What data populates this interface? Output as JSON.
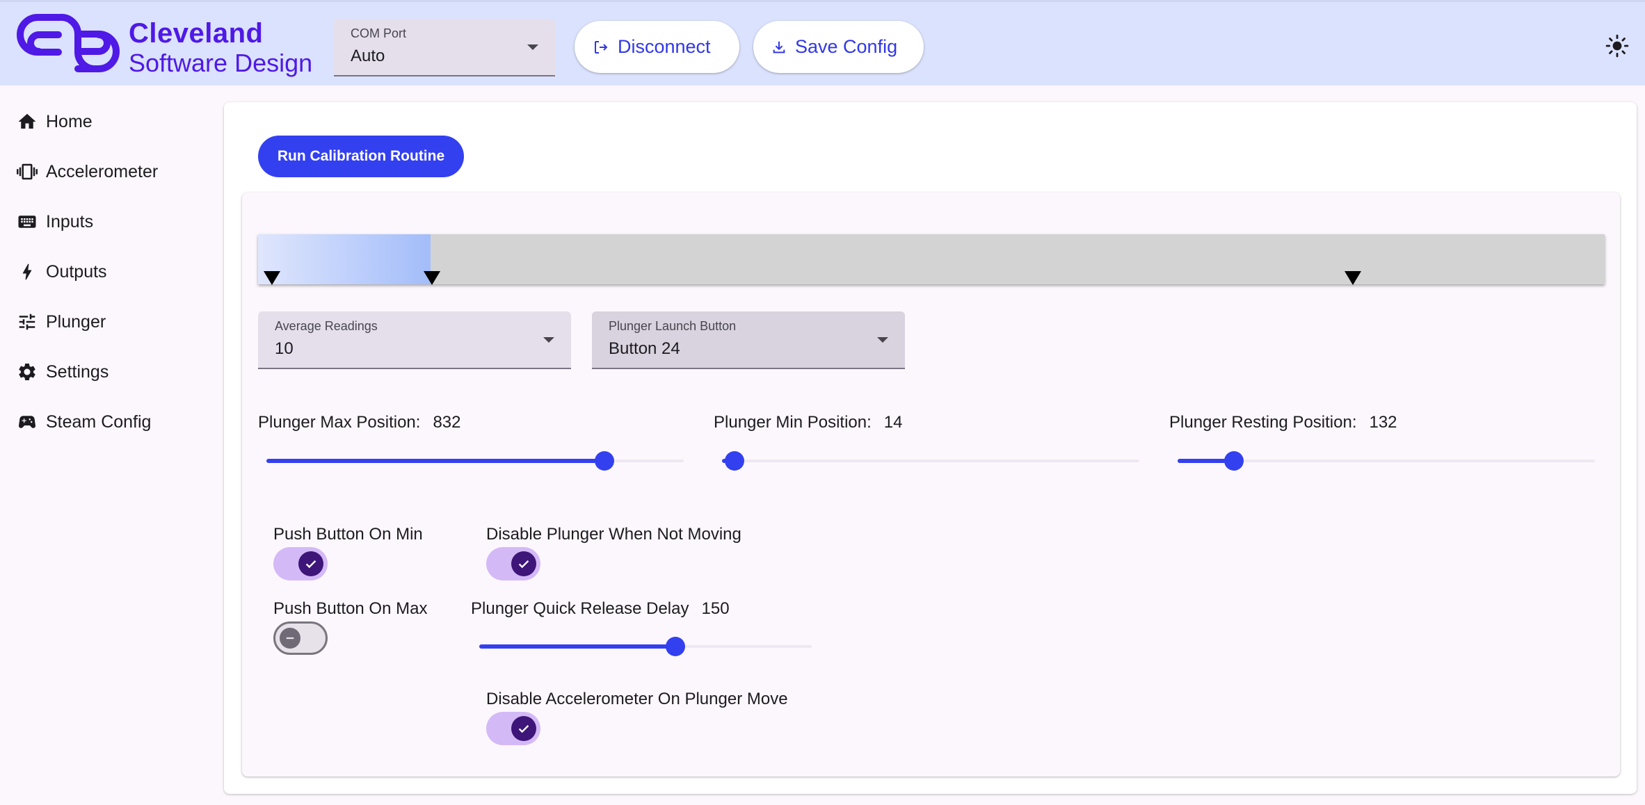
{
  "brand": {
    "line1": "Cleveland",
    "line2": "Software Design"
  },
  "header": {
    "com_port": {
      "label": "COM Port",
      "value": "Auto"
    },
    "disconnect_label": "Disconnect",
    "save_label": "Save Config"
  },
  "sidebar": {
    "items": [
      {
        "label": "Home",
        "icon": "home-icon"
      },
      {
        "label": "Accelerometer",
        "icon": "vibration-icon"
      },
      {
        "label": "Inputs",
        "icon": "keyboard-icon"
      },
      {
        "label": "Outputs",
        "icon": "bolt-icon"
      },
      {
        "label": "Plunger",
        "icon": "tune-icon"
      },
      {
        "label": "Settings",
        "icon": "gear-icon"
      },
      {
        "label": "Steam Config",
        "icon": "gamepad-icon"
      }
    ]
  },
  "main": {
    "calibrate_label": "Run Calibration Routine",
    "average_readings": {
      "label": "Average Readings",
      "value": "10"
    },
    "launch_button": {
      "label": "Plunger Launch Button",
      "value": "Button 24"
    },
    "max_position": {
      "label": "Plunger Max Position:",
      "value": "832",
      "fraction": 0.81
    },
    "min_position": {
      "label": "Plunger Min Position:",
      "value": "14",
      "fraction": 0.03
    },
    "resting_position": {
      "label": "Plunger Resting Position:",
      "value": "132",
      "fraction": 0.135
    },
    "quick_release": {
      "label": "Plunger Quick Release Delay",
      "value": "150",
      "fraction": 0.59
    },
    "switches": {
      "push_on_min": {
        "label": "Push Button On Min",
        "checked": true
      },
      "disable_not_moving": {
        "label": "Disable Plunger When Not Moving",
        "checked": true
      },
      "push_on_max": {
        "label": "Push Button On Max",
        "checked": false
      },
      "disable_accel": {
        "label": "Disable Accelerometer On Plunger Move",
        "checked": true
      }
    },
    "range_bar": {
      "min_fraction": 0.0,
      "rest_fraction": 0.128,
      "max_fraction": 0.812
    }
  },
  "colors": {
    "accent": "#3340f0",
    "brand": "#4f19e6",
    "header_bg": "#dbe2fd"
  }
}
